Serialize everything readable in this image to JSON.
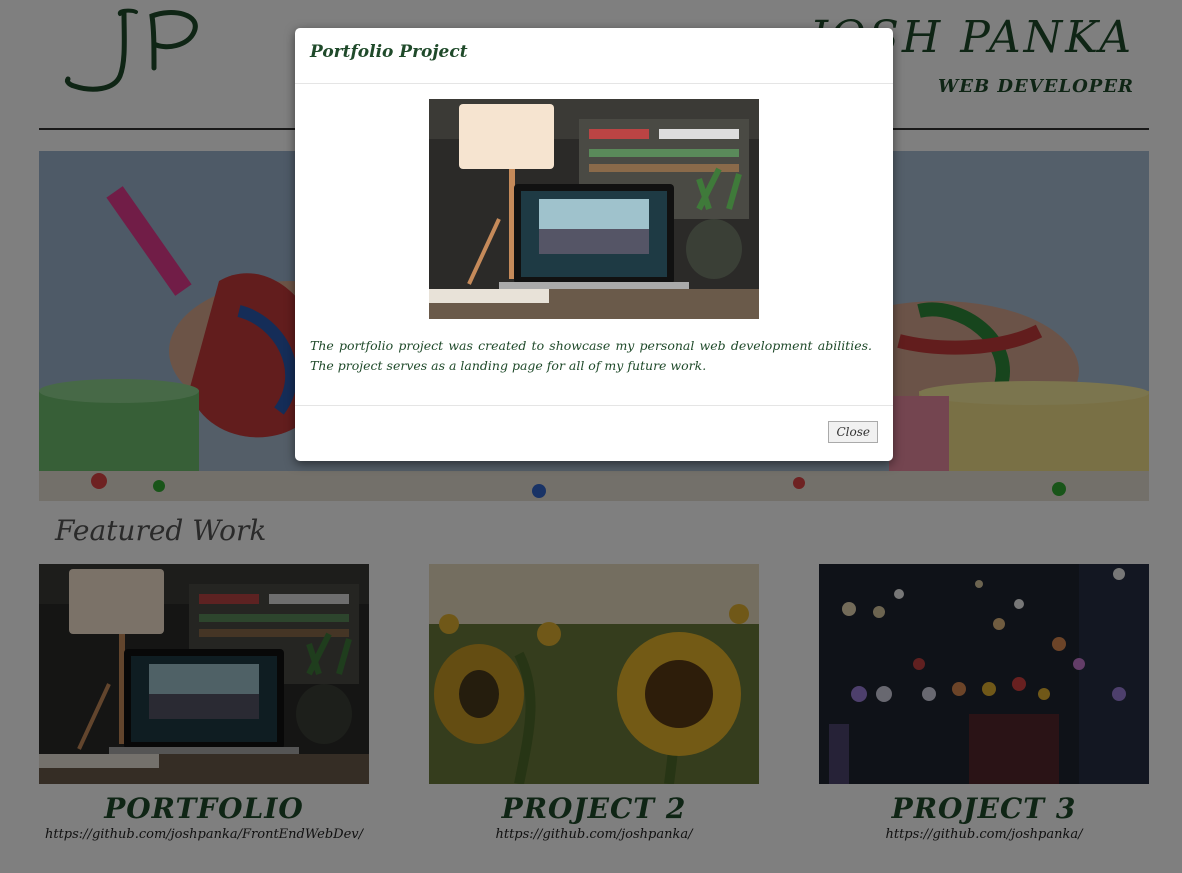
{
  "header": {
    "logo_text": "JP",
    "site_name": "JOSH PANKA",
    "subtitle": "WEB DEVELOPER"
  },
  "featured": {
    "title": "Featured Work",
    "projects": [
      {
        "title": "PORTFOLIO",
        "link": "https://github.com/joshpanka/FrontEndWebDev/"
      },
      {
        "title": "PROJECT 2",
        "link": "https://github.com/joshpanka/"
      },
      {
        "title": "PROJECT 3",
        "link": "https://github.com/joshpanka/"
      }
    ]
  },
  "modal": {
    "title": "Portfolio Project",
    "description": "The portfolio project was created to showcase my personal web development abilities. The project serves as a landing page for all of my future work.",
    "close_label": "Close"
  },
  "colors": {
    "brand_green": "#1f4a2a",
    "overlay": "rgba(0,0,0,0.5)"
  }
}
